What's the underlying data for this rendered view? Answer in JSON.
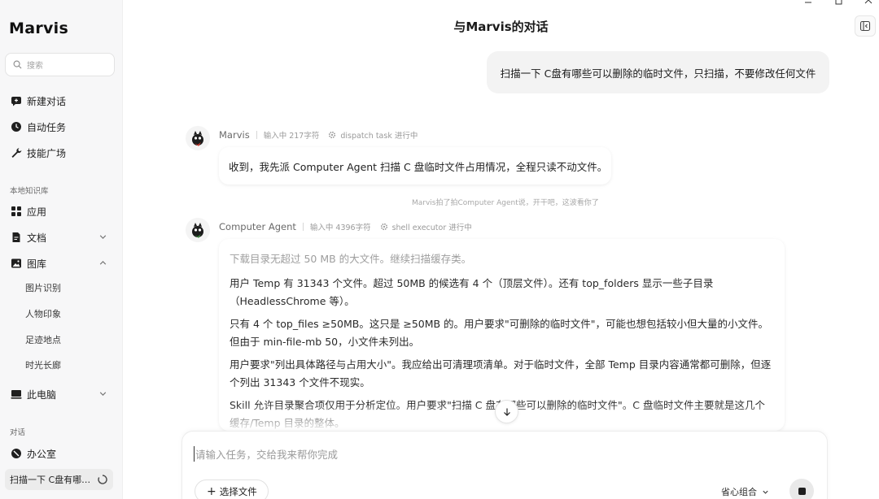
{
  "app": {
    "brand": "Marvis"
  },
  "sidebar": {
    "search_placeholder": "搜索",
    "top_items": [
      {
        "label": "新建对话",
        "icon": "new-chat-icon"
      },
      {
        "label": "自动任务",
        "icon": "clock-icon"
      },
      {
        "label": "技能广场",
        "icon": "wrench-icon"
      }
    ],
    "knowledge_label": "本地知识库",
    "knowledge_items": [
      {
        "label": "应用",
        "icon": "apps-grid-icon"
      },
      {
        "label": "文档",
        "icon": "document-icon"
      },
      {
        "label": "图库",
        "icon": "image-icon"
      }
    ],
    "gallery_subitems": [
      "图片识别",
      "人物印象",
      "足迹地点",
      "时光长廊"
    ],
    "computer_label": "此电脑",
    "conversation_label": "对话",
    "office_label": "办公室",
    "active_conversation": "扫描一下 C盘有哪…"
  },
  "header": {
    "title": "与Marvis的对话"
  },
  "chat": {
    "user_message": "扫描一下 C盘有哪些可以删除的临时文件，只扫描，不要修改任何文件",
    "msg1": {
      "sender": "Marvis",
      "status": "输入中 217字符",
      "task": "dispatch task 进行中",
      "text": "收到，我先派 Computer Agent 扫描 C 盘临时文件占用情况，全程只读不动文件。"
    },
    "system_note": "Marvis拍了拍Computer Agent说，开干吧，这波看你了",
    "msg2": {
      "sender": "Computer Agent",
      "status": "输入中 4396字符",
      "task": "shell executor 进行中",
      "paragraphs": [
        "下载目录无超过 50 MB 的大文件。继续扫描缓存类。",
        "用户 Temp 有 31343 个文件。超过 50MB 的候选有 4 个（顶层文件）。还有 top_folders 显示一些子目录（HeadlessChrome 等）。",
        "只有 4 个 top_files ≥50MB。这只是 ≥50MB 的。用户要求\"可删除的临时文件\"，可能也想包括较小但大量的小文件。但由于 min-file-mb 50，小文件未列出。",
        "用户要求\"列出具体路径与占用大小\"。我应给出可清理项清单。对于临时文件，全部 Temp 目录内容通常都可删除，但逐个列出 31343 个文件不现实。",
        "Skill 允许目录聚合项仅用于分析定位。用户要求\"扫描 C 盘有哪些可以删除的临时文件\"。C 盘临时文件主要就是这几个缓存/Temp 目录的整体。"
      ]
    }
  },
  "composer": {
    "placeholder": "请输入任务，交给我来帮你完成",
    "file_button": "选择文件",
    "mode": "省心组合"
  }
}
